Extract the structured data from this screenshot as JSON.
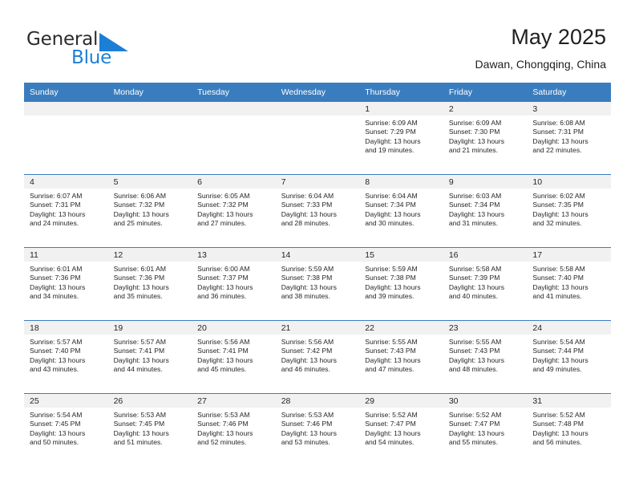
{
  "brand": {
    "name_part1": "General",
    "name_part2": "Blue",
    "logo_icon": "triangle-flag-icon"
  },
  "header": {
    "title": "May 2025",
    "subtitle": "Dawan, Chongqing, China"
  },
  "theme": {
    "header_blue": "#3a7dbf",
    "brand_blue": "#1c7fd6",
    "daynum_band": "#f1f1f1",
    "text": "#262626"
  },
  "calendar": {
    "weekday_headers": [
      "Sunday",
      "Monday",
      "Tuesday",
      "Wednesday",
      "Thursday",
      "Friday",
      "Saturday"
    ],
    "weeks": [
      [
        {
          "day": "",
          "sunrise": "",
          "sunset": "",
          "daylight_line1": "",
          "daylight_line2": ""
        },
        {
          "day": "",
          "sunrise": "",
          "sunset": "",
          "daylight_line1": "",
          "daylight_line2": ""
        },
        {
          "day": "",
          "sunrise": "",
          "sunset": "",
          "daylight_line1": "",
          "daylight_line2": ""
        },
        {
          "day": "",
          "sunrise": "",
          "sunset": "",
          "daylight_line1": "",
          "daylight_line2": ""
        },
        {
          "day": "1",
          "sunrise": "Sunrise: 6:09 AM",
          "sunset": "Sunset: 7:29 PM",
          "daylight_line1": "Daylight: 13 hours",
          "daylight_line2": "and 19 minutes."
        },
        {
          "day": "2",
          "sunrise": "Sunrise: 6:09 AM",
          "sunset": "Sunset: 7:30 PM",
          "daylight_line1": "Daylight: 13 hours",
          "daylight_line2": "and 21 minutes."
        },
        {
          "day": "3",
          "sunrise": "Sunrise: 6:08 AM",
          "sunset": "Sunset: 7:31 PM",
          "daylight_line1": "Daylight: 13 hours",
          "daylight_line2": "and 22 minutes."
        }
      ],
      [
        {
          "day": "4",
          "sunrise": "Sunrise: 6:07 AM",
          "sunset": "Sunset: 7:31 PM",
          "daylight_line1": "Daylight: 13 hours",
          "daylight_line2": "and 24 minutes."
        },
        {
          "day": "5",
          "sunrise": "Sunrise: 6:06 AM",
          "sunset": "Sunset: 7:32 PM",
          "daylight_line1": "Daylight: 13 hours",
          "daylight_line2": "and 25 minutes."
        },
        {
          "day": "6",
          "sunrise": "Sunrise: 6:05 AM",
          "sunset": "Sunset: 7:32 PM",
          "daylight_line1": "Daylight: 13 hours",
          "daylight_line2": "and 27 minutes."
        },
        {
          "day": "7",
          "sunrise": "Sunrise: 6:04 AM",
          "sunset": "Sunset: 7:33 PM",
          "daylight_line1": "Daylight: 13 hours",
          "daylight_line2": "and 28 minutes."
        },
        {
          "day": "8",
          "sunrise": "Sunrise: 6:04 AM",
          "sunset": "Sunset: 7:34 PM",
          "daylight_line1": "Daylight: 13 hours",
          "daylight_line2": "and 30 minutes."
        },
        {
          "day": "9",
          "sunrise": "Sunrise: 6:03 AM",
          "sunset": "Sunset: 7:34 PM",
          "daylight_line1": "Daylight: 13 hours",
          "daylight_line2": "and 31 minutes."
        },
        {
          "day": "10",
          "sunrise": "Sunrise: 6:02 AM",
          "sunset": "Sunset: 7:35 PM",
          "daylight_line1": "Daylight: 13 hours",
          "daylight_line2": "and 32 minutes."
        }
      ],
      [
        {
          "day": "11",
          "sunrise": "Sunrise: 6:01 AM",
          "sunset": "Sunset: 7:36 PM",
          "daylight_line1": "Daylight: 13 hours",
          "daylight_line2": "and 34 minutes."
        },
        {
          "day": "12",
          "sunrise": "Sunrise: 6:01 AM",
          "sunset": "Sunset: 7:36 PM",
          "daylight_line1": "Daylight: 13 hours",
          "daylight_line2": "and 35 minutes."
        },
        {
          "day": "13",
          "sunrise": "Sunrise: 6:00 AM",
          "sunset": "Sunset: 7:37 PM",
          "daylight_line1": "Daylight: 13 hours",
          "daylight_line2": "and 36 minutes."
        },
        {
          "day": "14",
          "sunrise": "Sunrise: 5:59 AM",
          "sunset": "Sunset: 7:38 PM",
          "daylight_line1": "Daylight: 13 hours",
          "daylight_line2": "and 38 minutes."
        },
        {
          "day": "15",
          "sunrise": "Sunrise: 5:59 AM",
          "sunset": "Sunset: 7:38 PM",
          "daylight_line1": "Daylight: 13 hours",
          "daylight_line2": "and 39 minutes."
        },
        {
          "day": "16",
          "sunrise": "Sunrise: 5:58 AM",
          "sunset": "Sunset: 7:39 PM",
          "daylight_line1": "Daylight: 13 hours",
          "daylight_line2": "and 40 minutes."
        },
        {
          "day": "17",
          "sunrise": "Sunrise: 5:58 AM",
          "sunset": "Sunset: 7:40 PM",
          "daylight_line1": "Daylight: 13 hours",
          "daylight_line2": "and 41 minutes."
        }
      ],
      [
        {
          "day": "18",
          "sunrise": "Sunrise: 5:57 AM",
          "sunset": "Sunset: 7:40 PM",
          "daylight_line1": "Daylight: 13 hours",
          "daylight_line2": "and 43 minutes."
        },
        {
          "day": "19",
          "sunrise": "Sunrise: 5:57 AM",
          "sunset": "Sunset: 7:41 PM",
          "daylight_line1": "Daylight: 13 hours",
          "daylight_line2": "and 44 minutes."
        },
        {
          "day": "20",
          "sunrise": "Sunrise: 5:56 AM",
          "sunset": "Sunset: 7:41 PM",
          "daylight_line1": "Daylight: 13 hours",
          "daylight_line2": "and 45 minutes."
        },
        {
          "day": "21",
          "sunrise": "Sunrise: 5:56 AM",
          "sunset": "Sunset: 7:42 PM",
          "daylight_line1": "Daylight: 13 hours",
          "daylight_line2": "and 46 minutes."
        },
        {
          "day": "22",
          "sunrise": "Sunrise: 5:55 AM",
          "sunset": "Sunset: 7:43 PM",
          "daylight_line1": "Daylight: 13 hours",
          "daylight_line2": "and 47 minutes."
        },
        {
          "day": "23",
          "sunrise": "Sunrise: 5:55 AM",
          "sunset": "Sunset: 7:43 PM",
          "daylight_line1": "Daylight: 13 hours",
          "daylight_line2": "and 48 minutes."
        },
        {
          "day": "24",
          "sunrise": "Sunrise: 5:54 AM",
          "sunset": "Sunset: 7:44 PM",
          "daylight_line1": "Daylight: 13 hours",
          "daylight_line2": "and 49 minutes."
        }
      ],
      [
        {
          "day": "25",
          "sunrise": "Sunrise: 5:54 AM",
          "sunset": "Sunset: 7:45 PM",
          "daylight_line1": "Daylight: 13 hours",
          "daylight_line2": "and 50 minutes."
        },
        {
          "day": "26",
          "sunrise": "Sunrise: 5:53 AM",
          "sunset": "Sunset: 7:45 PM",
          "daylight_line1": "Daylight: 13 hours",
          "daylight_line2": "and 51 minutes."
        },
        {
          "day": "27",
          "sunrise": "Sunrise: 5:53 AM",
          "sunset": "Sunset: 7:46 PM",
          "daylight_line1": "Daylight: 13 hours",
          "daylight_line2": "and 52 minutes."
        },
        {
          "day": "28",
          "sunrise": "Sunrise: 5:53 AM",
          "sunset": "Sunset: 7:46 PM",
          "daylight_line1": "Daylight: 13 hours",
          "daylight_line2": "and 53 minutes."
        },
        {
          "day": "29",
          "sunrise": "Sunrise: 5:52 AM",
          "sunset": "Sunset: 7:47 PM",
          "daylight_line1": "Daylight: 13 hours",
          "daylight_line2": "and 54 minutes."
        },
        {
          "day": "30",
          "sunrise": "Sunrise: 5:52 AM",
          "sunset": "Sunset: 7:47 PM",
          "daylight_line1": "Daylight: 13 hours",
          "daylight_line2": "and 55 minutes."
        },
        {
          "day": "31",
          "sunrise": "Sunrise: 5:52 AM",
          "sunset": "Sunset: 7:48 PM",
          "daylight_line1": "Daylight: 13 hours",
          "daylight_line2": "and 56 minutes."
        }
      ]
    ]
  }
}
